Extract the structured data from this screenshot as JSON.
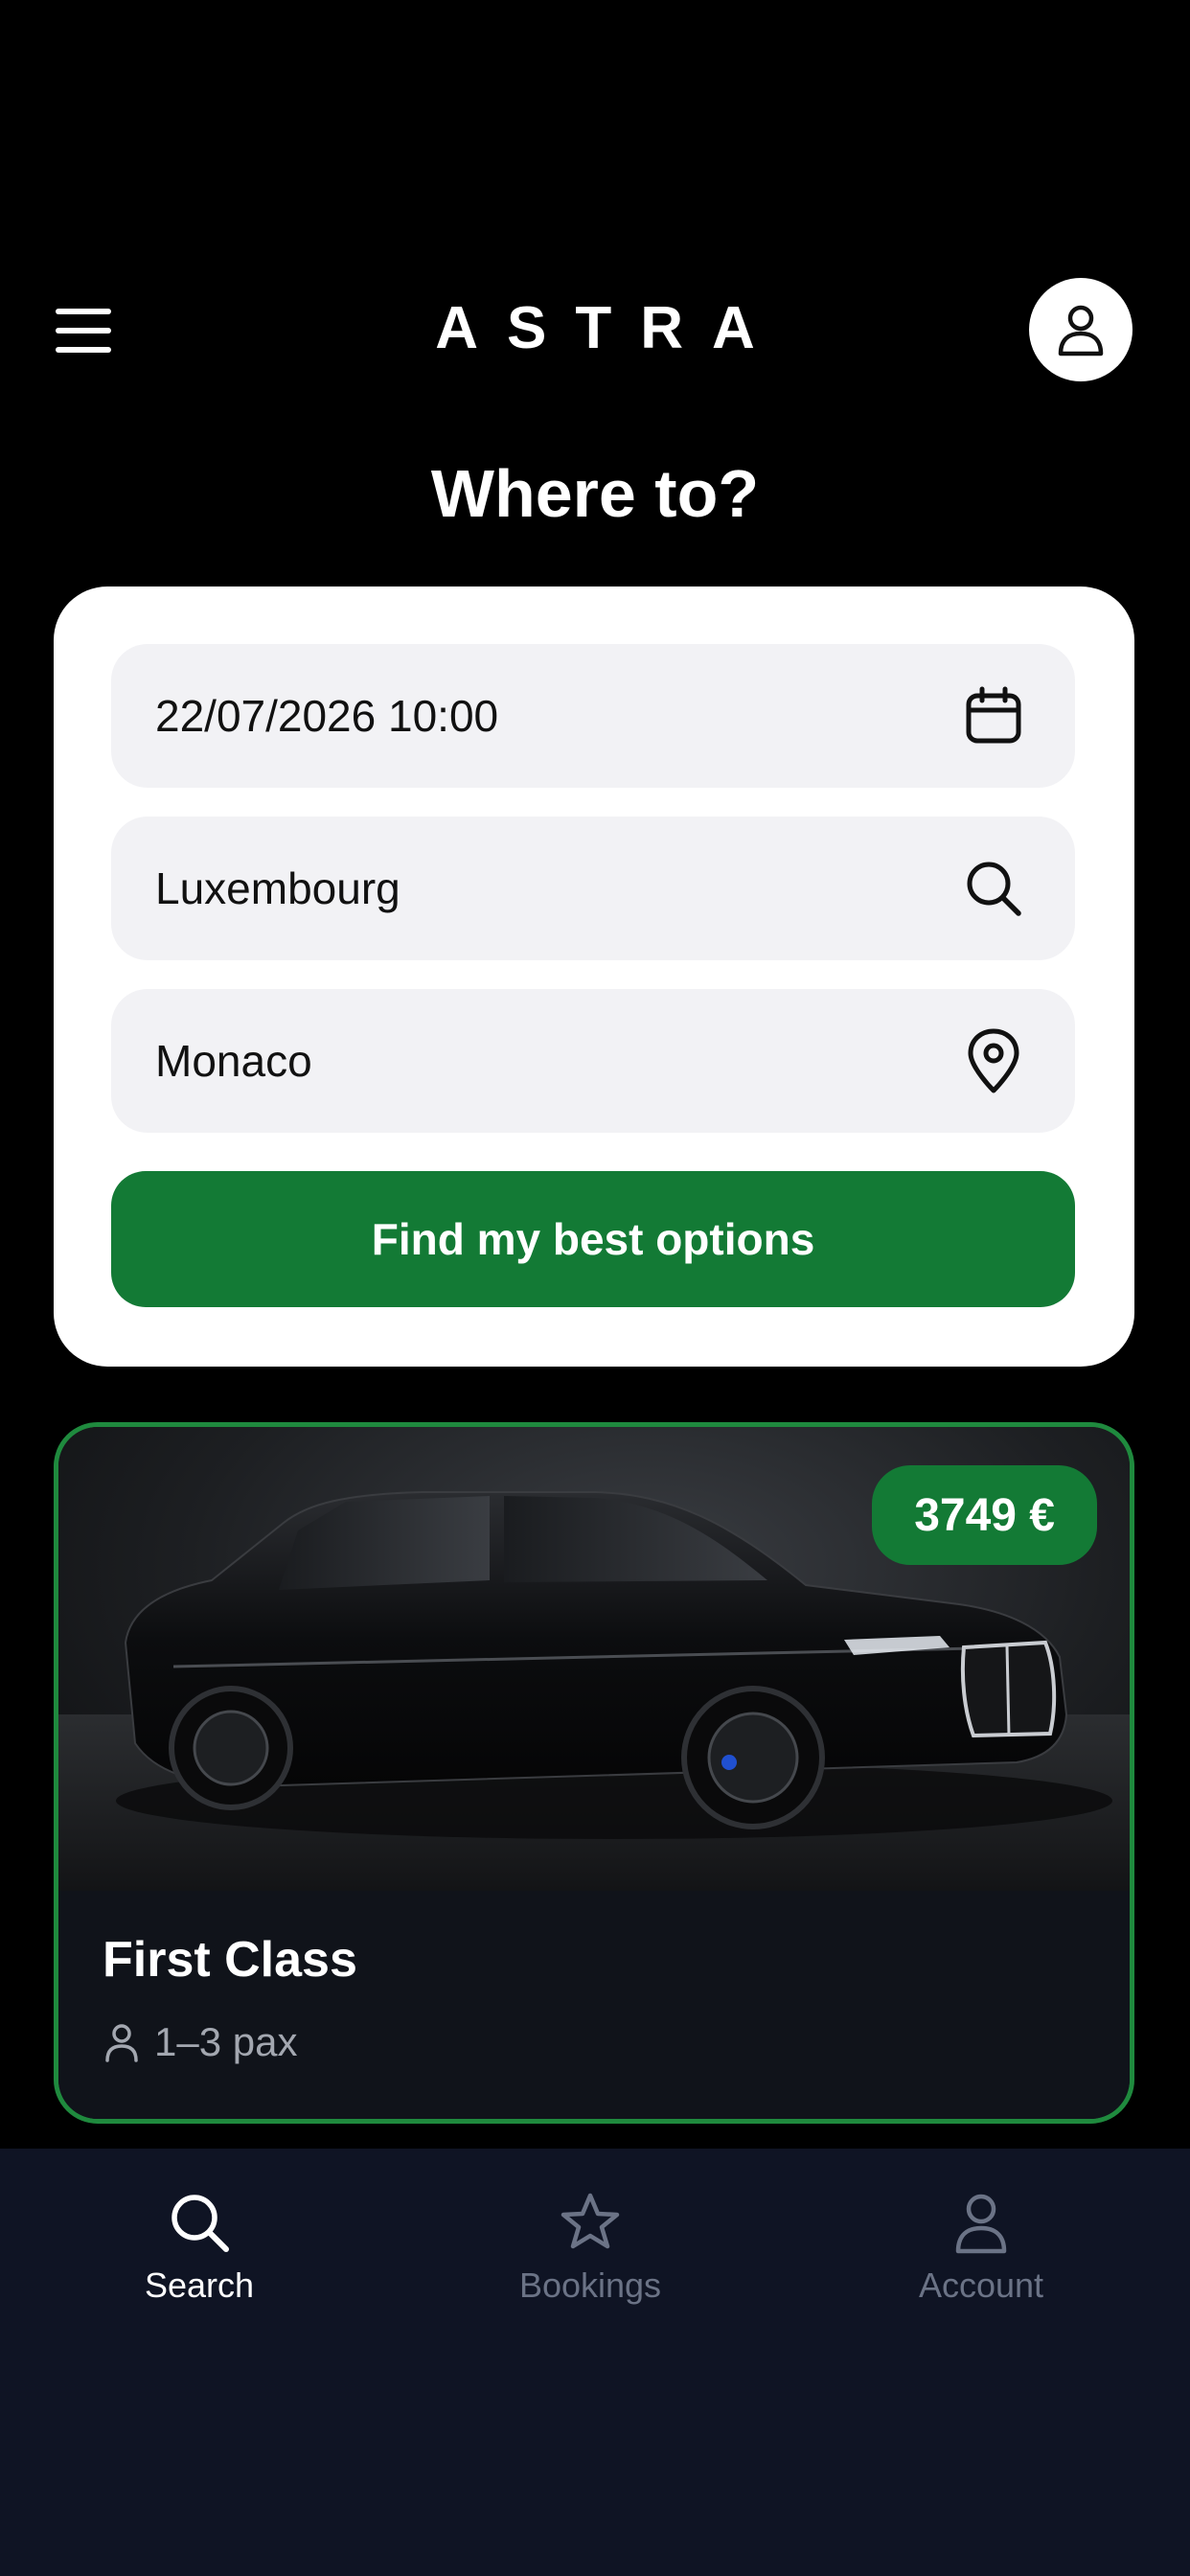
{
  "header": {
    "brand": "ASTRA",
    "menu_icon": "hamburger-menu-icon",
    "profile_icon": "user-icon"
  },
  "page_title": "Where to?",
  "search_form": {
    "datetime_value": "22/07/2026 10:00",
    "datetime_icon": "calendar-icon",
    "pickup_value": "Luxembourg",
    "pickup_icon": "search-icon",
    "dropoff_value": "Monaco",
    "dropoff_icon": "map-pin-icon",
    "submit_label": "Find my best options"
  },
  "vehicle": {
    "price": "3749 €",
    "name": "First Class",
    "capacity": "1–3 pax",
    "capacity_icon": "person-icon"
  },
  "bottom_nav": {
    "items": [
      {
        "label": "Search",
        "icon": "search-icon",
        "active": true
      },
      {
        "label": "Bookings",
        "icon": "star-icon",
        "active": false
      },
      {
        "label": "Account",
        "icon": "user-icon",
        "active": false
      }
    ]
  },
  "colors": {
    "background": "#000000",
    "accent_green": "#137a35",
    "card_border": "#1f8a3e",
    "nav_background": "#0f1424",
    "nav_inactive": "#6b7386"
  }
}
